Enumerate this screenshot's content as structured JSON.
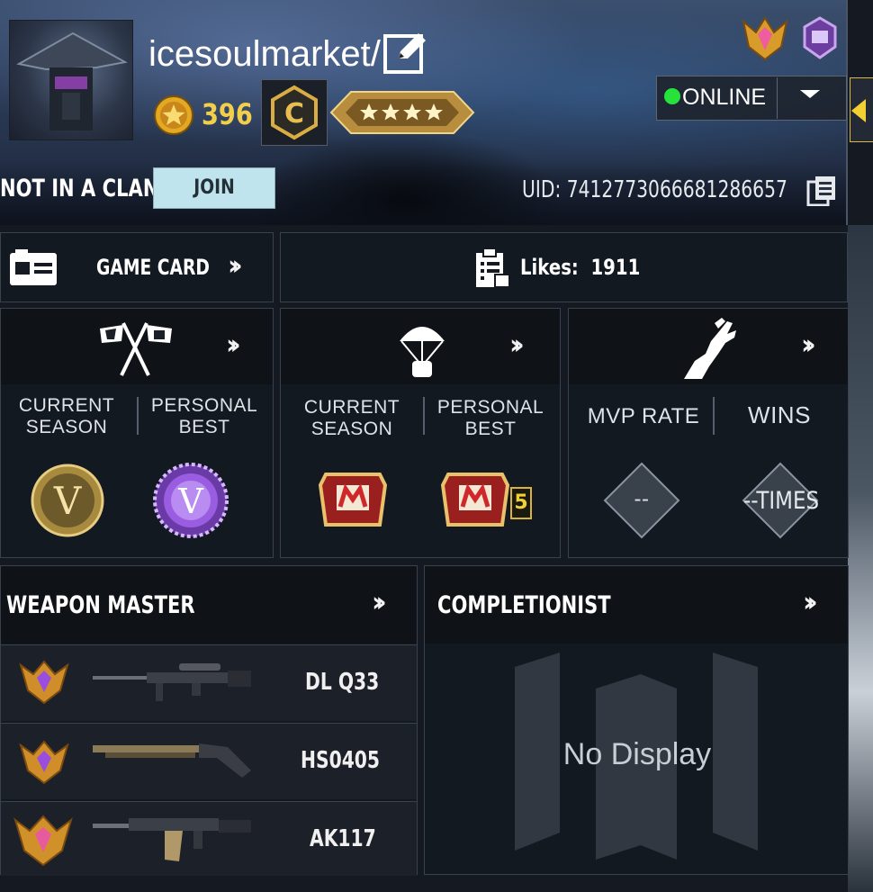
{
  "header": {
    "username": "icesoulmarket/",
    "coins": "396",
    "status": "ONLINE",
    "clan_text": "NOT IN A CLAN",
    "join_label": "JOIN",
    "uid": "UID: 7412773066681286657",
    "rank_letter": "C"
  },
  "cards": {
    "game_card_label": "GAME CARD",
    "likes_label": "Likes:",
    "likes_value": "1911"
  },
  "stats": {
    "mp": {
      "current_label_1": "CURRENT",
      "current_label_2": "SEASON",
      "best_label_1": "PERSONAL",
      "best_label_2": "BEST"
    },
    "br": {
      "current_label_1": "CURRENT",
      "current_label_2": "SEASON",
      "best_label_1": "PERSONAL",
      "best_label_2": "BEST",
      "best_count": "5"
    },
    "zombie": {
      "mvp_label": "MVP RATE",
      "wins_label": "WINS",
      "mvp_value": "--",
      "wins_value": "--TIMES"
    }
  },
  "weapon_master": {
    "title": "WEAPON MASTER",
    "weapons": [
      {
        "name": "DL Q33"
      },
      {
        "name": "HS0405"
      },
      {
        "name": "AK117"
      }
    ]
  },
  "completionist": {
    "title": "COMPLETIONIST",
    "empty_text": "No Display"
  },
  "colors": {
    "online": "#27e23a",
    "coin": "#f2cf4a",
    "join_bg": "#bfe4ee"
  }
}
